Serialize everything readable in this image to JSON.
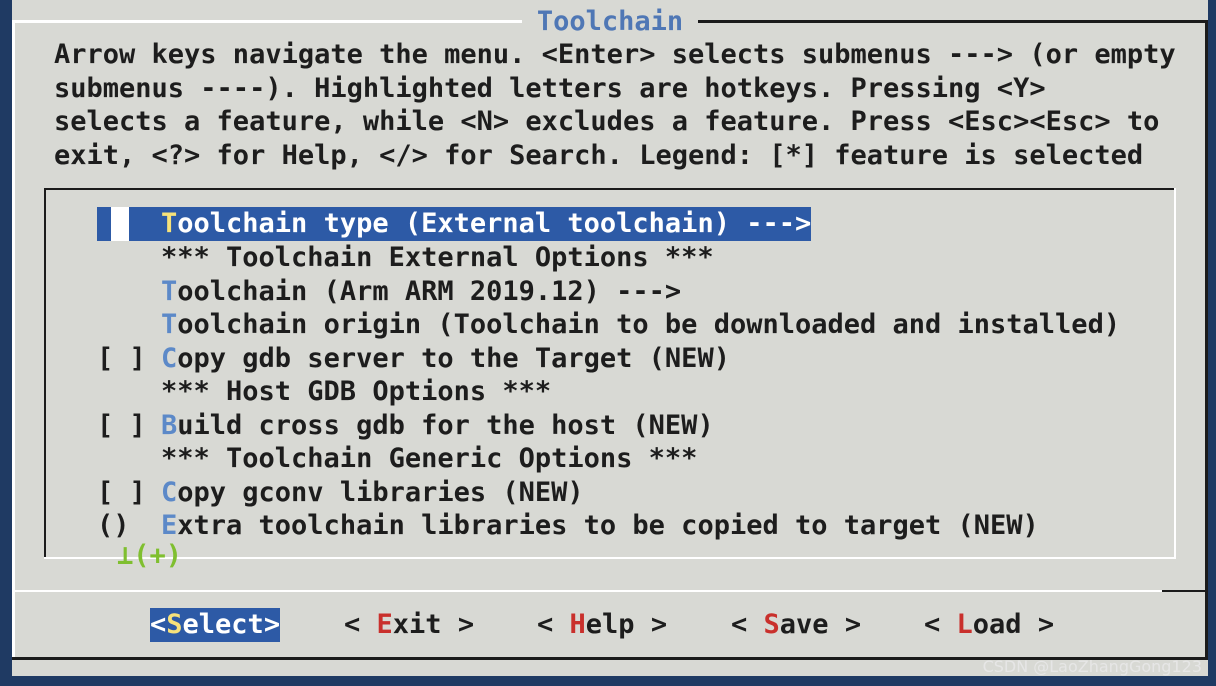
{
  "window": {
    "title": "Toolchain"
  },
  "help_text": {
    "lines": [
      "Arrow keys navigate the menu.  <Enter> selects submenus ---> (or empty",
      "submenus ----).  Highlighted letters are hotkeys.  Pressing <Y>",
      "selects a feature, while <N> excludes a feature.  Press <Esc><Esc> to",
      "exit, <?> for Help, </> for Search.  Legend: [*] feature is selected"
    ]
  },
  "menu": {
    "items": [
      {
        "mark": "",
        "hotkey": "T",
        "rest": "oolchain type (External toolchain)  --->",
        "selected": true
      },
      {
        "mark": "",
        "hotkey": "",
        "rest": "*** Toolchain External Options ***",
        "selected": false
      },
      {
        "mark": "",
        "hotkey": "T",
        "rest": "oolchain (Arm ARM 2019.12)  --->",
        "selected": false
      },
      {
        "mark": "",
        "hotkey": "T",
        "rest": "oolchain origin (Toolchain to be downloaded and installed)",
        "selected": false
      },
      {
        "mark": "[ ]",
        "hotkey": "C",
        "rest": "opy gdb server to the Target (NEW)",
        "selected": false
      },
      {
        "mark": "",
        "hotkey": "",
        "rest": "*** Host GDB Options ***",
        "selected": false
      },
      {
        "mark": "[ ]",
        "hotkey": "B",
        "rest": "uild cross gdb for the host (NEW)",
        "selected": false
      },
      {
        "mark": "",
        "hotkey": "",
        "rest": "*** Toolchain Generic Options ***",
        "selected": false
      },
      {
        "mark": "[ ]",
        "hotkey": "C",
        "rest": "opy gconv libraries (NEW)",
        "selected": false
      },
      {
        "mark": "()",
        "hotkey": "E",
        "rest": "xtra toolchain libraries to be copied to target (NEW)",
        "selected": false
      }
    ],
    "more_indicator": "⊥(+)"
  },
  "buttons": [
    {
      "prefix": "<",
      "hotkey": "S",
      "rest": "elect",
      "suffix": ">",
      "active": true
    },
    {
      "prefix": "< ",
      "hotkey": "E",
      "rest": "xit",
      "suffix": " >",
      "active": false
    },
    {
      "prefix": "< ",
      "hotkey": "H",
      "rest": "elp",
      "suffix": " >",
      "active": false
    },
    {
      "prefix": "< ",
      "hotkey": "S",
      "rest": "ave",
      "suffix": " >",
      "active": false
    },
    {
      "prefix": "< ",
      "hotkey": "L",
      "rest": "oad",
      "suffix": " >",
      "active": false
    }
  ],
  "watermark": "CSDN @LaoZhangGong123",
  "colors": {
    "dialog_bg": "#d8d9d4",
    "screen_bg": "#1f3a63",
    "title": "#4f77b5",
    "selection_bg": "#2d5aa6",
    "hotkey": "#5c89c8",
    "selected_hotkey": "#f7e27a",
    "button_hotkey": "#c9302c",
    "more_indicator": "#7fbf2f"
  }
}
